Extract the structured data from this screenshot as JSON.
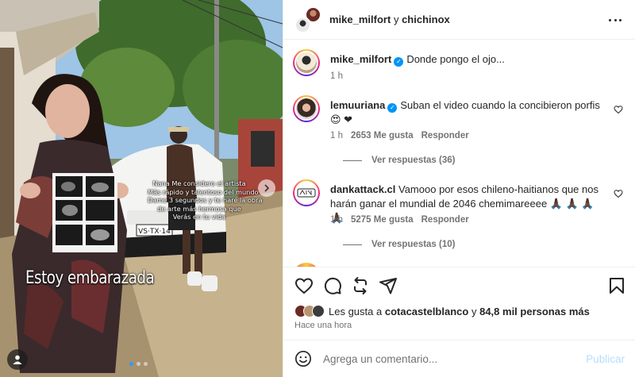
{
  "post": {
    "author_primary": "mike_milfort",
    "connector": "y",
    "author_secondary": "chichinox"
  },
  "media": {
    "overlay_lines": [
      "Nana Me considero el artista",
      "Más rápido y talentoso del mundo",
      "Dame 3 segundos y te haré la obra",
      "de arte más hermosa que",
      "Verás en tu vida"
    ],
    "caption_big": "Estoy embarazada",
    "plate": "VS·TX·14",
    "carousel_count": 3,
    "carousel_active": 1
  },
  "caption": {
    "username": "mike_milfort",
    "text": "Donde pongo el ojo...",
    "time": "1 h"
  },
  "comments": [
    {
      "username": "lemuuriana",
      "verified": true,
      "text": "Suban el video cuando la concibieron porfis 😍 ❤",
      "time": "1 h",
      "likes": "2653 Me gusta",
      "reply": "Responder",
      "replies": "Ver respuestas (36)"
    },
    {
      "username": "dankattack.cl",
      "verified": false,
      "text": "Vamooo por esos chileno-haitianos que nos harán ganar el mundial de 2046 chemimareeee 🙏🏿 🙏🏿 🙏🏿 🙏🏿",
      "time": "1 h",
      "likes": "5275 Me gusta",
      "reply": "Responder",
      "replies": "Ver respuestas (10)"
    }
  ],
  "likes": {
    "prefix": "Les gusta a",
    "user": "cotacastelblanco",
    "middle": "y",
    "others": "84,8 mil personas más"
  },
  "timestamp": "Hace una hora",
  "composer": {
    "placeholder": "Agrega un comentario...",
    "post_label": "Publicar"
  },
  "colors": {
    "accent": "#0095f6",
    "muted": "#737373",
    "post_disabled": "#b2dffc"
  }
}
